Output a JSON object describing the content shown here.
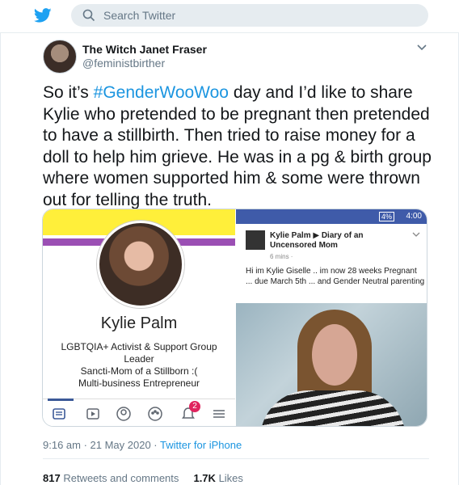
{
  "header": {
    "search_placeholder": "Search Twitter",
    "brand_color": "#1da1f2"
  },
  "tweet": {
    "author_name": "The Witch Janet Fraser",
    "author_handle": "@feministbirther",
    "text_before": "So it’s ",
    "hashtag": "#GenderWooWoo",
    "text_after": " day and I’d like to share Kylie who pretended to be pregnant then pretended to have a stillbirth. Then tried to raise money for a doll to help him grieve. He was in a pg & birth group where women supported him & some were thrown out for telling the truth.",
    "timestamp": "9:16 am · 21 May 2020 · ",
    "source": "Twitter for iPhone",
    "retweets_count": "817",
    "retweets_label": "Retweets and comments",
    "likes_count": "1.7K",
    "likes_label": "Likes"
  },
  "media_left": {
    "name": "Kylie Palm",
    "bio_lines": [
      "LGBTQIA+ Activist & Support Group",
      "Leader",
      "Sancti-Mom of a Stillborn :(",
      "Multi-business Entrepreneur"
    ],
    "notification_count": "2"
  },
  "media_right": {
    "status_time": "4:00",
    "battery": "4%",
    "post_author": "Kylie Palm ▶ Diary of an Uncensored Mom",
    "post_time": "6 mins ·",
    "post_text": "Hi im Kylie Giselle .. im now 28 weeks Pregnant ... due March 5th ... and Gender Neutral parenting"
  }
}
